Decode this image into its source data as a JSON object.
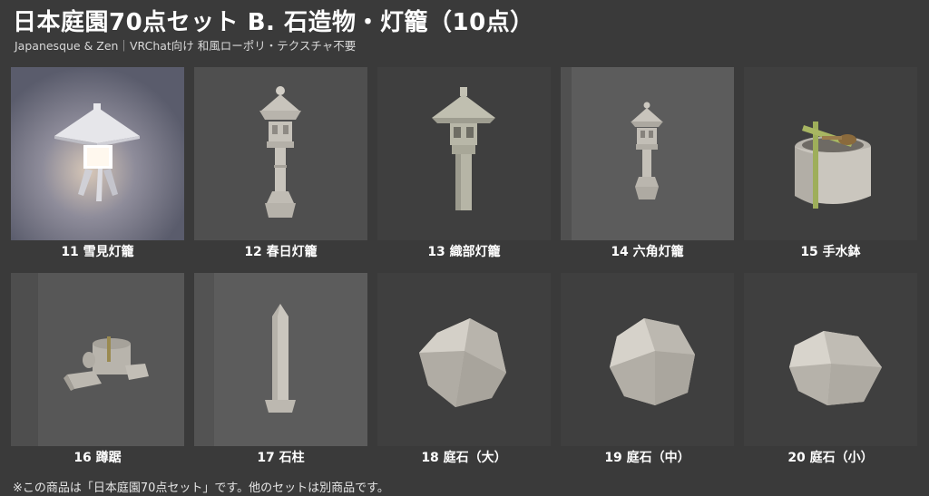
{
  "header": {
    "title": "日本庭園70点セット B. 石造物・灯籠（10点）",
    "subtitle": "Japanesque & Zen｜VRChat向け 和風ローポリ・テクスチャ不要"
  },
  "items": [
    {
      "label": "11 雪見灯籠",
      "icon": "yukimi-lantern-icon"
    },
    {
      "label": "12 春日灯籠",
      "icon": "kasuga-lantern-icon"
    },
    {
      "label": "13 織部灯籠",
      "icon": "oribe-lantern-icon"
    },
    {
      "label": "14 六角灯籠",
      "icon": "hexagonal-lantern-icon"
    },
    {
      "label": "15 手水鉢",
      "icon": "water-basin-icon"
    },
    {
      "label": "16 蹲踞",
      "icon": "tsukubai-icon"
    },
    {
      "label": "17 石柱",
      "icon": "stone-pillar-icon"
    },
    {
      "label": "18 庭石（大）",
      "icon": "large-rock-icon"
    },
    {
      "label": "19 庭石（中）",
      "icon": "medium-rock-icon"
    },
    {
      "label": "20 庭石（小）",
      "icon": "small-rock-icon"
    }
  ],
  "footer": {
    "note": "※この商品は「日本庭園70点セット」です。他のセットは別商品です。"
  },
  "colors": {
    "background": "#3a3a3a",
    "tile": "#575757",
    "stone": "#c8c4bc",
    "bamboo": "#9aa868"
  }
}
